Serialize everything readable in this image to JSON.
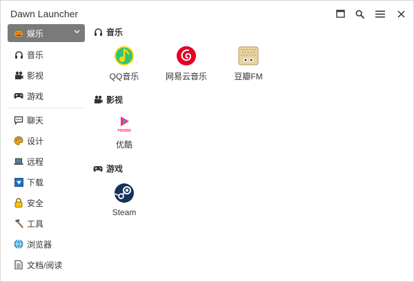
{
  "window": {
    "title": "Dawn Launcher"
  },
  "titlebar": {
    "buttons": [
      "window-icon",
      "search-icon",
      "menu-icon",
      "close-icon"
    ]
  },
  "sidebar": {
    "items": [
      {
        "label": "娱乐",
        "icon": "pumpkin-icon",
        "active": true
      },
      {
        "label": "音乐",
        "icon": "headphones-icon"
      },
      {
        "label": "影视",
        "icon": "film-icon"
      },
      {
        "label": "游戏",
        "icon": "gamepad-icon"
      },
      {
        "label": "聊天",
        "icon": "chat-icon"
      },
      {
        "label": "设计",
        "icon": "palette-icon"
      },
      {
        "label": "远程",
        "icon": "laptop-icon"
      },
      {
        "label": "下载",
        "icon": "download-icon"
      },
      {
        "label": "安全",
        "icon": "lock-icon"
      },
      {
        "label": "工具",
        "icon": "hammer-icon"
      },
      {
        "label": "浏览器",
        "icon": "globe-icon"
      },
      {
        "label": "文档/阅读",
        "icon": "document-icon"
      }
    ]
  },
  "sections": [
    {
      "title": "音乐",
      "icon": "headphones-icon",
      "apps": [
        {
          "label": "QQ音乐",
          "icon": "qq-music-icon"
        },
        {
          "label": "网易云音乐",
          "icon": "netease-music-icon"
        },
        {
          "label": "豆瓣FM",
          "icon": "douban-fm-icon"
        }
      ]
    },
    {
      "title": "影视",
      "icon": "film-icon",
      "apps": [
        {
          "label": "优酷",
          "icon": "youku-icon",
          "logo_text": "YOUKU"
        }
      ]
    },
    {
      "title": "游戏",
      "icon": "gamepad-icon",
      "apps": [
        {
          "label": "Steam",
          "icon": "steam-icon"
        }
      ]
    }
  ],
  "colors": {
    "active_bg": "#7a7a7a",
    "qq_green": "#31c27c",
    "qq_yellow": "#ffda00",
    "netease_red": "#e60026",
    "youku_pink": "#ff2b6b",
    "youku_blue": "#20a7f5",
    "steam_dark": "#17325a"
  }
}
